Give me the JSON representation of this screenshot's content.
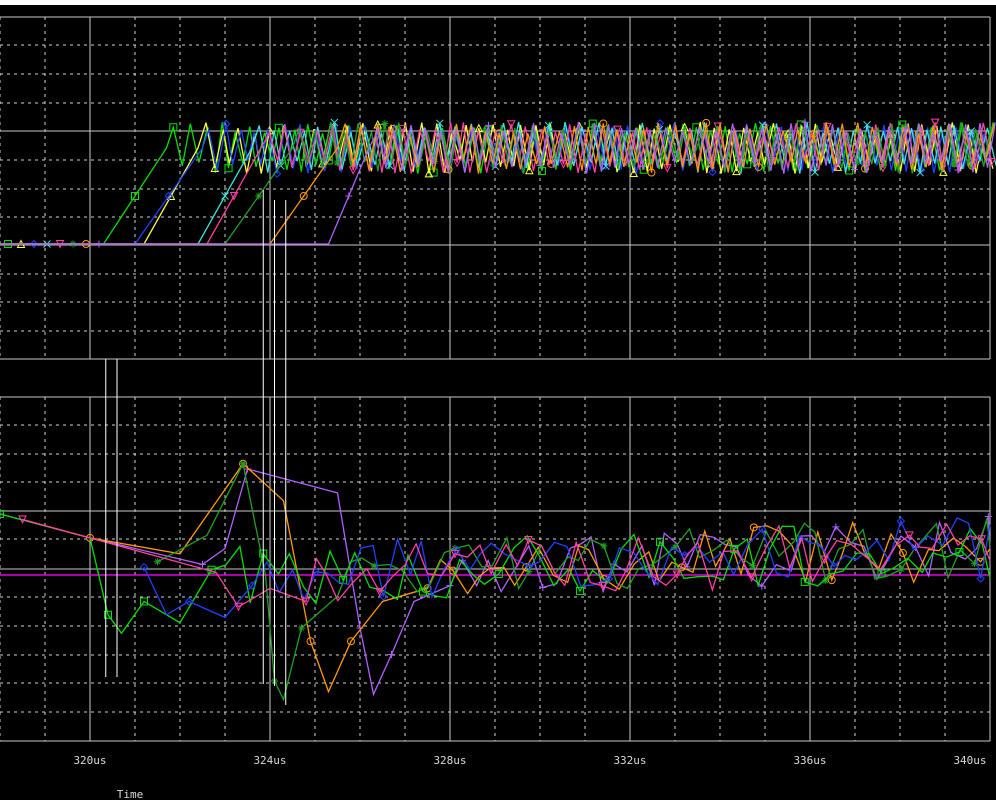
{
  "chart_data": [
    {
      "type": "line",
      "title": "",
      "xlabel": "",
      "ylabel": "",
      "xlim": [
        318,
        340
      ],
      "grid": true,
      "series": [
        {
          "color": "#00e000",
          "start": 320.3,
          "rise_us": 1.4,
          "marker": "square"
        },
        {
          "color": "#ffff40",
          "start": 321.2,
          "rise_us": 1.2,
          "marker": "triangle"
        },
        {
          "color": "#2040ff",
          "start": 321.0,
          "rise_us": 1.5,
          "marker": "diamond"
        },
        {
          "color": "#40e0e0",
          "start": 322.4,
          "rise_us": 1.2,
          "marker": "x"
        },
        {
          "color": "#ff40a0",
          "start": 322.6,
          "rise_us": 1.2,
          "marker": "triangle-down"
        },
        {
          "color": "#20a020",
          "start": 323.0,
          "rise_us": 1.5,
          "marker": "star"
        },
        {
          "color": "#ff9900",
          "start": 324.0,
          "rise_us": 1.5,
          "marker": "circle"
        },
        {
          "color": "#b060ff",
          "start": 325.3,
          "rise_us": 0.9,
          "marker": "plus"
        }
      ]
    },
    {
      "type": "line",
      "title": "",
      "xlabel": "Time",
      "ylabel": "",
      "xlim": [
        318,
        340
      ],
      "ylim": [
        -8,
        7
      ],
      "grid": true,
      "x_ticks": [
        {
          "value": 320,
          "label": "320us"
        },
        {
          "value": 324,
          "label": "324us"
        },
        {
          "value": 328,
          "label": "328us"
        },
        {
          "value": 332,
          "label": "332us"
        },
        {
          "value": 336,
          "label": "336us"
        },
        {
          "value": 340,
          "label": "340us"
        }
      ],
      "baseline": {
        "color": "#e000e0",
        "y": 0
      },
      "series": [
        {
          "color": "#b060ff",
          "marker": "plus",
          "points": [
            [
              318.0,
              2.3
            ],
            [
              320.0,
              1.4
            ],
            [
              322.5,
              0.4
            ],
            [
              323.0,
              1.0
            ],
            [
              323.5,
              4.0
            ],
            [
              325.5,
              3.1
            ],
            [
              326.0,
              -2.0
            ],
            [
              326.3,
              -4.5
            ],
            [
              326.7,
              -3.0
            ],
            [
              327.2,
              -1.0
            ],
            [
              328.0,
              -0.4
            ]
          ]
        },
        {
          "color": "#ff9900",
          "marker": "circle",
          "points": [
            [
              320.0,
              1.4
            ],
            [
              322.0,
              0.8
            ],
            [
              323.4,
              4.2
            ],
            [
              324.3,
              2.8
            ],
            [
              324.9,
              -2.5
            ],
            [
              325.3,
              -4.4
            ],
            [
              325.8,
              -2.5
            ],
            [
              326.5,
              -1.0
            ],
            [
              327.5,
              -0.5
            ]
          ]
        },
        {
          "color": "#20a020",
          "marker": "star",
          "points": [
            [
              321.5,
              0.5
            ],
            [
              322.6,
              1.5
            ],
            [
              323.4,
              4.2
            ],
            [
              323.9,
              0.0
            ],
            [
              324.1,
              -4.0
            ],
            [
              324.3,
              -4.7
            ],
            [
              324.7,
              -2.0
            ],
            [
              325.5,
              -0.8
            ]
          ]
        },
        {
          "color": "#00e000",
          "marker": "square",
          "points": [
            [
              318.0,
              2.3
            ],
            [
              320.0,
              1.4
            ],
            [
              320.4,
              -1.5
            ],
            [
              320.7,
              -2.2
            ],
            [
              321.2,
              -1.0
            ],
            [
              322.0,
              -1.8
            ],
            [
              322.7,
              0.2
            ]
          ]
        },
        {
          "color": "#2040ff",
          "marker": "diamond",
          "points": [
            [
              321.2,
              0.3
            ],
            [
              321.7,
              -1.5
            ],
            [
              322.2,
              -1.0
            ],
            [
              323.0,
              -1.6
            ],
            [
              323.6,
              -0.4
            ]
          ]
        },
        {
          "color": "#ff40a0",
          "marker": "triangle-down",
          "points": [
            [
              318.5,
              2.1
            ],
            [
              322.8,
              0.1
            ],
            [
              323.3,
              -1.2
            ],
            [
              324.0,
              -0.5
            ],
            [
              324.8,
              -1.0
            ]
          ]
        }
      ]
    }
  ]
}
